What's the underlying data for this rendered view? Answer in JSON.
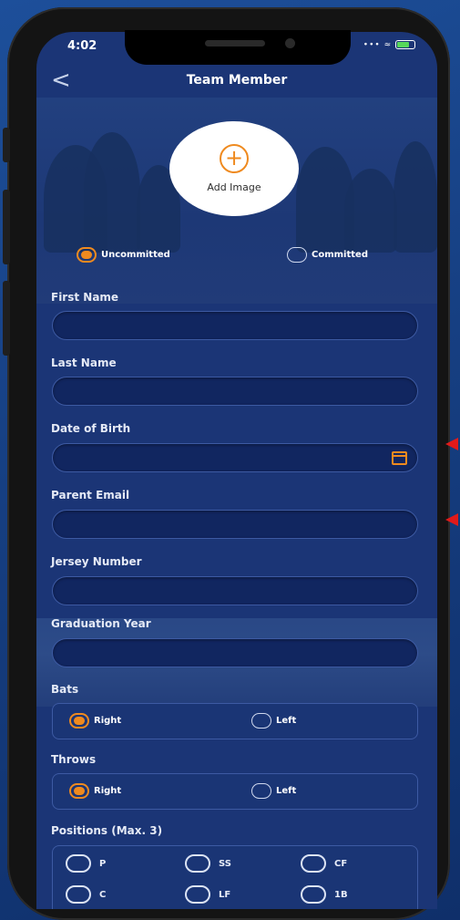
{
  "status_bar": {
    "time": "4:02",
    "signal": "••• ≈"
  },
  "nav": {
    "back": "<",
    "title": "Team Member"
  },
  "photo": {
    "plus": "+",
    "label": "Add Image"
  },
  "commitment": [
    {
      "label": "Uncommitted",
      "selected": true
    },
    {
      "label": "Committed",
      "selected": false
    }
  ],
  "fields": [
    {
      "label": "First Name",
      "value": ""
    },
    {
      "label": "Last Name",
      "value": ""
    },
    {
      "label": "Date of Birth",
      "value": "",
      "icon": "calendar-icon"
    },
    {
      "label": "Parent Email",
      "value": ""
    },
    {
      "label": "Jersey Number",
      "value": ""
    },
    {
      "label": "Graduation Year",
      "value": ""
    }
  ],
  "bats": {
    "label": "Bats",
    "options": [
      {
        "label": "Right",
        "selected": true
      },
      {
        "label": "Left",
        "selected": false
      }
    ]
  },
  "throws": {
    "label": "Throws",
    "options": [
      {
        "label": "Right",
        "selected": true
      },
      {
        "label": "Left",
        "selected": false
      }
    ]
  },
  "positions": {
    "label": "Positions (Max. 3)",
    "options": [
      "P",
      "SS",
      "CF",
      "C",
      "LF",
      "1B"
    ]
  },
  "colors": {
    "accent": "#ef8a1f",
    "background": "#1b3576",
    "annotation": "#e11a1a"
  }
}
